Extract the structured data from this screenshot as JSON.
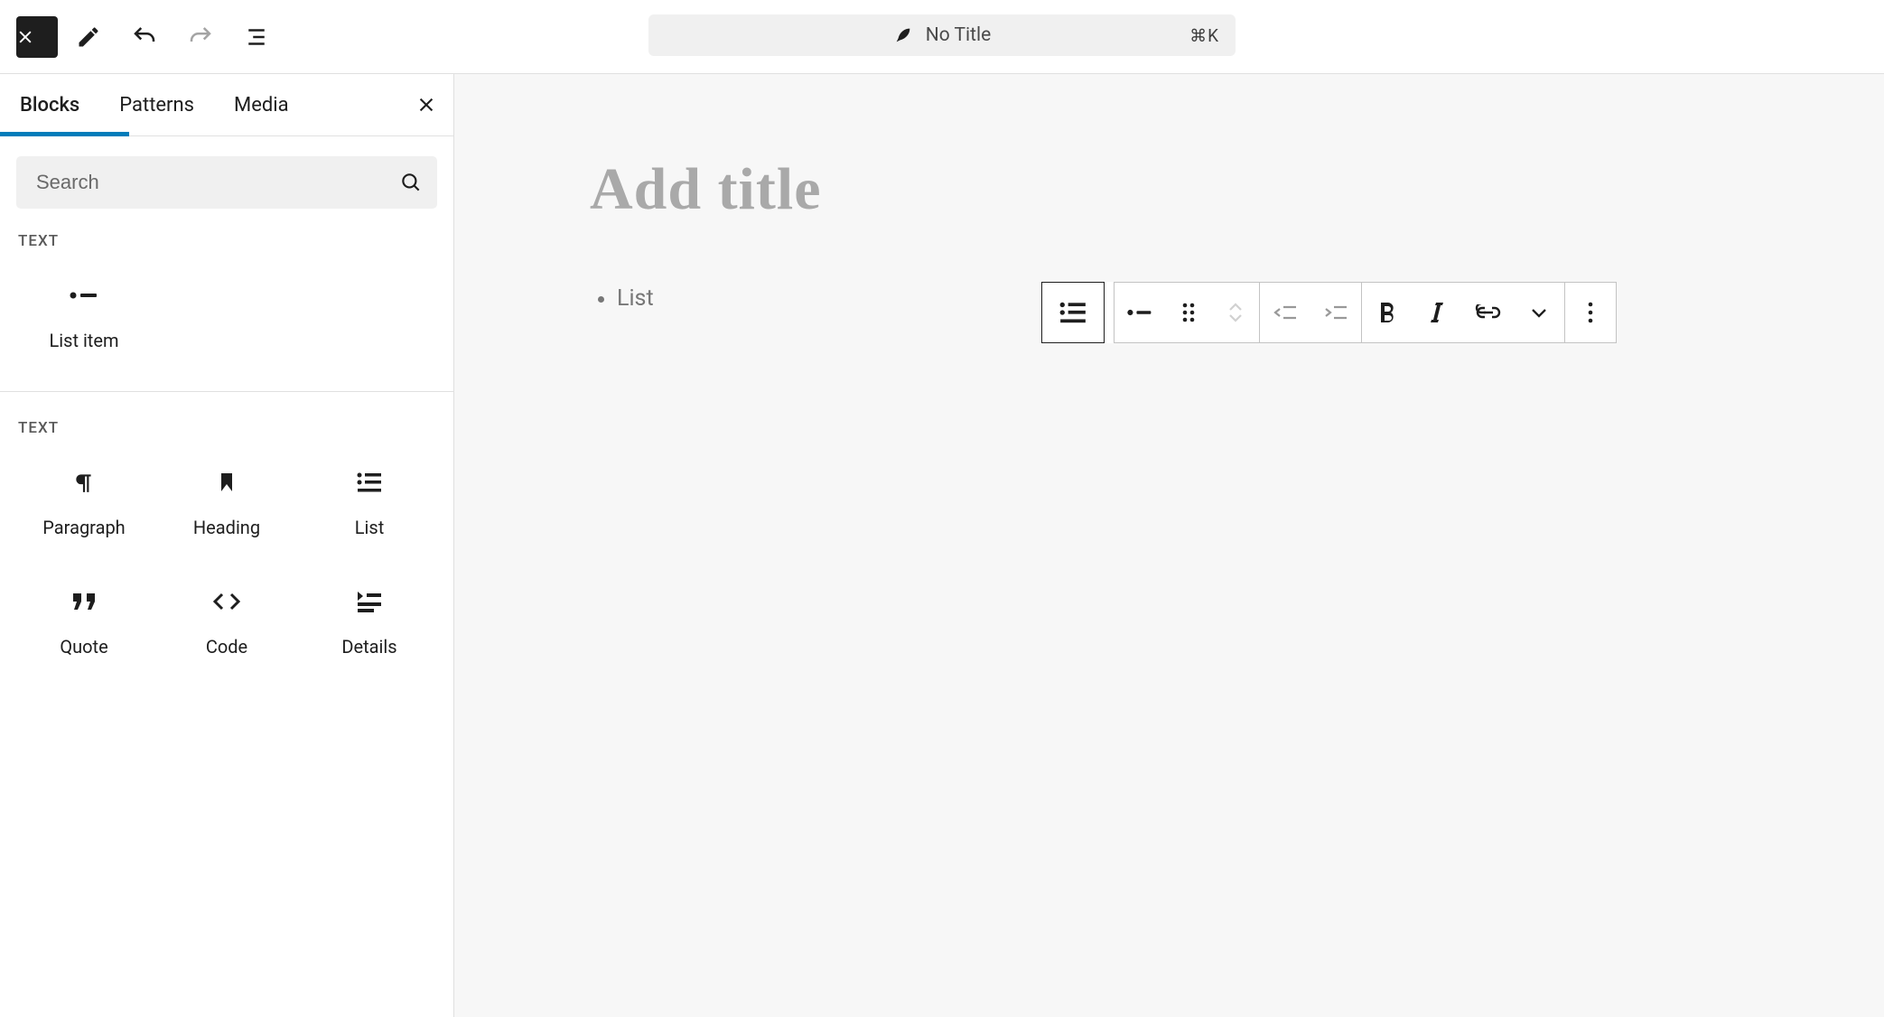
{
  "topbar": {
    "title": "No Title",
    "shortcut": "⌘K"
  },
  "sidebar": {
    "tabs": {
      "blocks": "Blocks",
      "patterns": "Patterns",
      "media": "Media"
    },
    "search_placeholder": "Search",
    "section_1_title": "TEXT",
    "section_1_items": [
      {
        "label": "List item",
        "icon": "list-item"
      }
    ],
    "section_2_title": "TEXT",
    "section_2_items": [
      {
        "label": "Paragraph",
        "icon": "paragraph"
      },
      {
        "label": "Heading",
        "icon": "heading"
      },
      {
        "label": "List",
        "icon": "list"
      },
      {
        "label": "Quote",
        "icon": "quote"
      },
      {
        "label": "Code",
        "icon": "code"
      },
      {
        "label": "Details",
        "icon": "details"
      }
    ]
  },
  "editor": {
    "title_placeholder": "Add title",
    "list_item_placeholder": "List"
  }
}
